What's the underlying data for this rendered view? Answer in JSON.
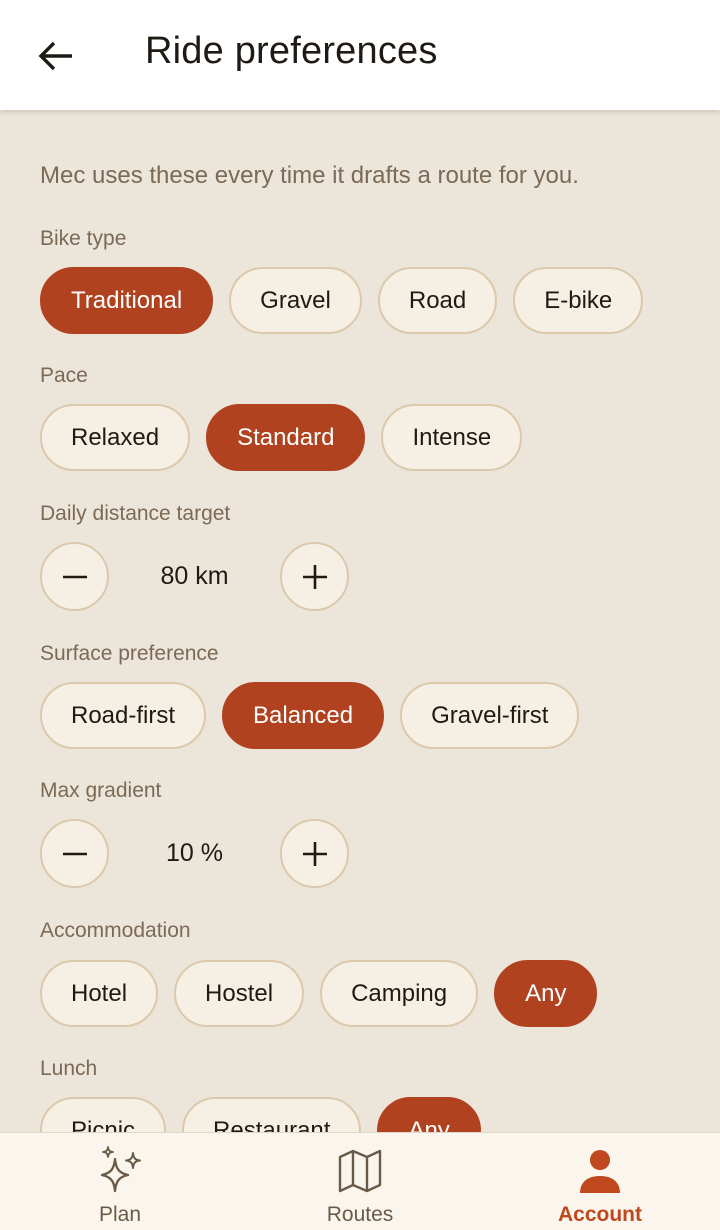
{
  "header": {
    "title": "Ride preferences",
    "back_icon": "arrow-left-icon"
  },
  "intro": "Mec uses these every time it drafts a route for you.",
  "sections": {
    "bike_type": {
      "label": "Bike type",
      "options": [
        "Traditional",
        "Gravel",
        "Road",
        "E-bike"
      ],
      "selected": "Traditional"
    },
    "pace": {
      "label": "Pace",
      "options": [
        "Relaxed",
        "Standard",
        "Intense"
      ],
      "selected": "Standard"
    },
    "daily_distance": {
      "label": "Daily distance target",
      "value": "80 km"
    },
    "surface": {
      "label": "Surface preference",
      "options": [
        "Road-first",
        "Balanced",
        "Gravel-first"
      ],
      "selected": "Balanced"
    },
    "max_gradient": {
      "label": "Max gradient",
      "value": "10 %"
    },
    "accommodation": {
      "label": "Accommodation",
      "options": [
        "Hotel",
        "Hostel",
        "Camping",
        "Any"
      ],
      "selected": "Any"
    },
    "lunch": {
      "label": "Lunch",
      "options": [
        "Picnic",
        "Restaurant",
        "Any"
      ],
      "selected": "Any"
    }
  },
  "bottom_nav": {
    "items": [
      {
        "label": "Plan",
        "icon": "sparkles-icon",
        "active": false
      },
      {
        "label": "Routes",
        "icon": "map-icon",
        "active": false
      },
      {
        "label": "Account",
        "icon": "person-icon",
        "active": true
      }
    ]
  },
  "colors": {
    "accent": "#b04220",
    "background": "#ece5d9",
    "chip_bg": "#f6efe3",
    "chip_border": "#dcc9ad",
    "muted_text": "#7b6a56"
  }
}
